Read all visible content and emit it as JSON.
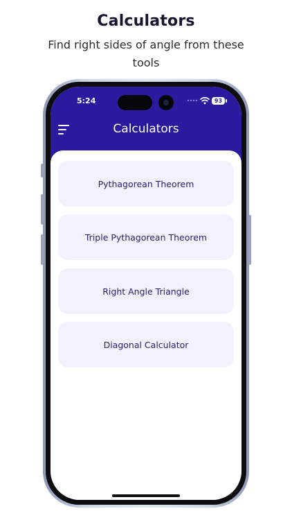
{
  "promo": {
    "title": "Calculators",
    "subtitle": "Find right sides of angle from these tools"
  },
  "status_bar": {
    "time": "5:24",
    "battery": "93"
  },
  "app_bar": {
    "title": "Calculators",
    "menu_icon": "hamburger-menu-icon"
  },
  "calculators": [
    {
      "label": "Pythagorean Theorem"
    },
    {
      "label": "Triple Pythagorean Theorem"
    },
    {
      "label": "Right Angle Triangle"
    },
    {
      "label": "Diagonal Calculator"
    }
  ],
  "colors": {
    "app_bar": "#2c1a9e",
    "card_background": "#f3f1fd",
    "card_text": "#2a1d6e"
  }
}
